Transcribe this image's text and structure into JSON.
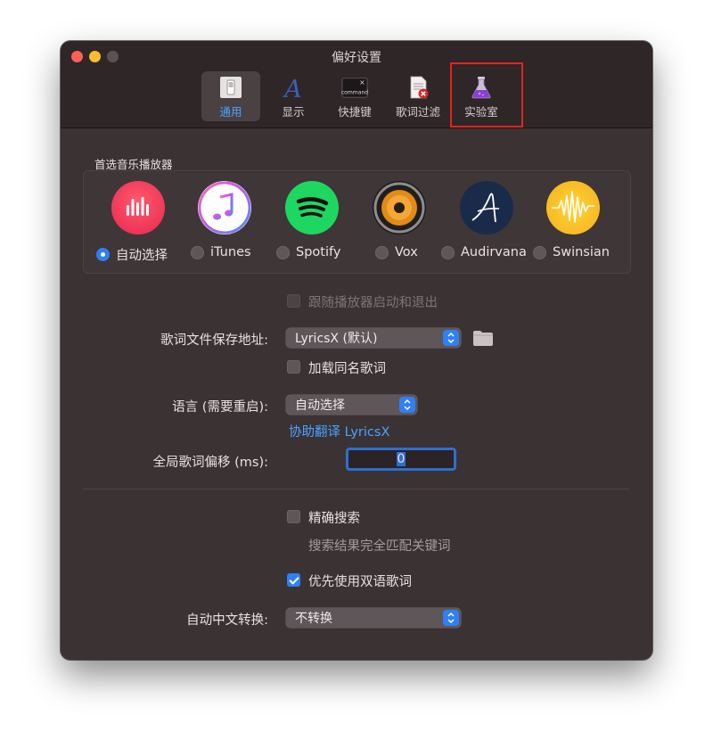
{
  "window": {
    "title": "偏好设置"
  },
  "toolbar": {
    "items": [
      {
        "label": "通用",
        "icon": "general-switch-icon",
        "active": true
      },
      {
        "label": "显示",
        "icon": "font-a-icon",
        "active": false
      },
      {
        "label": "快捷键",
        "icon": "command-key-icon",
        "active": false
      },
      {
        "label": "歌词过滤",
        "icon": "document-block-icon",
        "active": false
      },
      {
        "label": "实验室",
        "icon": "flask-icon",
        "active": false
      }
    ],
    "command_key_text": "command"
  },
  "player_section": {
    "label": "首选音乐播放器",
    "players": [
      {
        "label": "自动选择",
        "icon": "auto-select-icon",
        "selected": true
      },
      {
        "label": "iTunes",
        "icon": "itunes-icon",
        "selected": false
      },
      {
        "label": "Spotify",
        "icon": "spotify-icon",
        "selected": false
      },
      {
        "label": "Vox",
        "icon": "vox-icon",
        "selected": false
      },
      {
        "label": "Audirvana",
        "icon": "audirvana-icon",
        "selected": false
      },
      {
        "label": "Swinsian",
        "icon": "swinsian-icon",
        "selected": false
      }
    ]
  },
  "follow_player": {
    "label": "跟随播放器启动和退出",
    "checked": false,
    "disabled": true
  },
  "save_location": {
    "label": "歌词文件保存地址:",
    "value": "LyricsX (默认)"
  },
  "load_same_name": {
    "label": "加载同名歌词",
    "checked": false
  },
  "language": {
    "label": "语言 (需要重启):",
    "value": "自动选择",
    "link": "协助翻译 LyricsX"
  },
  "offset": {
    "label": "全局歌词偏移 (ms):",
    "value": "0"
  },
  "precise_search": {
    "label": "精确搜索",
    "checked": false,
    "hint": "搜索结果完全匹配关键词"
  },
  "bilingual": {
    "label": "优先使用双语歌词",
    "checked": true
  },
  "chinese_conversion": {
    "label": "自动中文转换:",
    "value": "不转换"
  },
  "colors": {
    "accent": "#2f7ff6",
    "link": "#4aa3ff",
    "highlight": "#e0261f",
    "window_bg": "#3b3234"
  }
}
